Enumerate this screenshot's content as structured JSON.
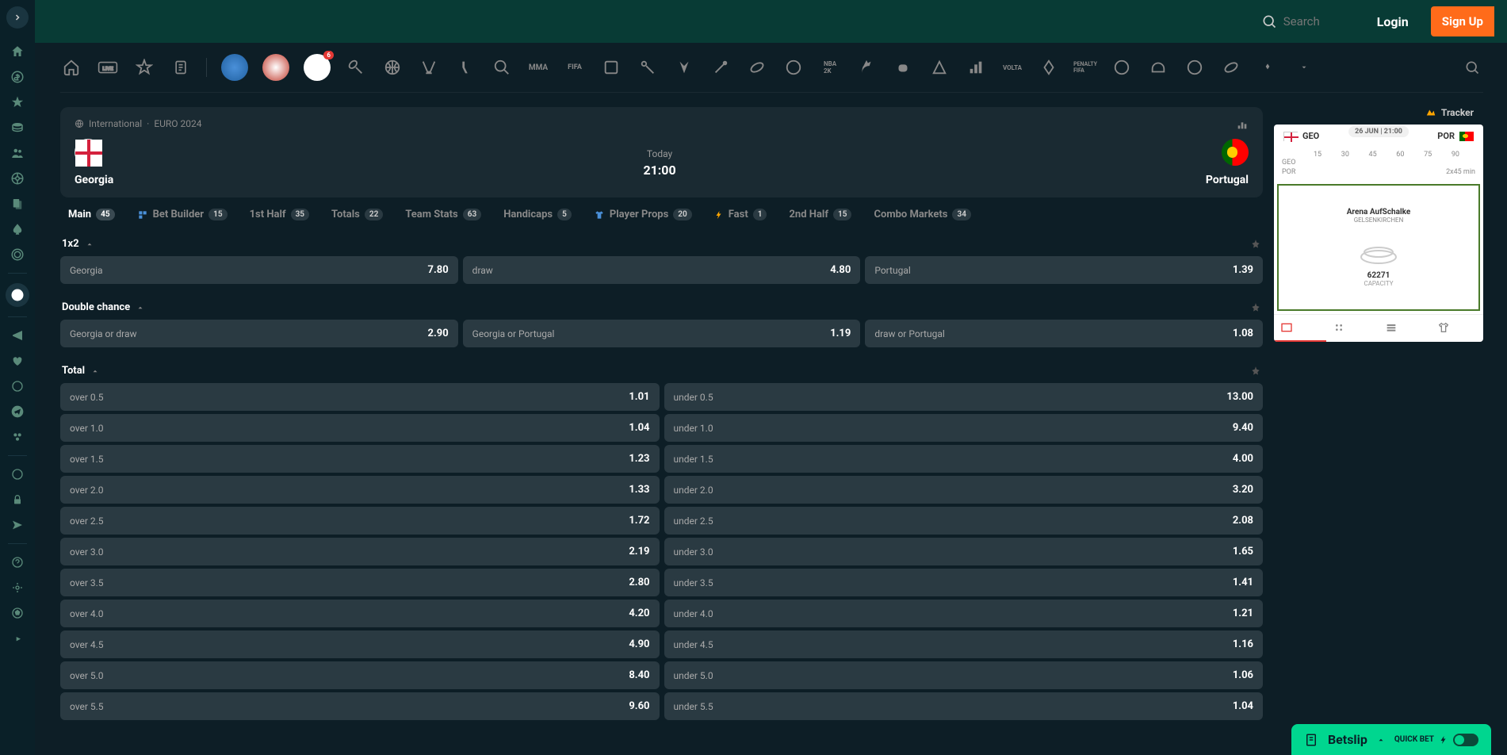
{
  "header": {
    "search_placeholder": "Search",
    "login": "Login",
    "signup": "Sign Up"
  },
  "breadcrumb": {
    "league": "International",
    "event": "EURO 2024"
  },
  "match": {
    "home_team": "Georgia",
    "away_team": "Portugal",
    "day": "Today",
    "time": "21:00"
  },
  "tabs": [
    {
      "label": "Main",
      "count": "45",
      "active": true
    },
    {
      "label": "Bet Builder",
      "count": "15",
      "icon": "builder"
    },
    {
      "label": "1st Half",
      "count": "35"
    },
    {
      "label": "Totals",
      "count": "22"
    },
    {
      "label": "Team Stats",
      "count": "63"
    },
    {
      "label": "Handicaps",
      "count": "5"
    },
    {
      "label": "Player Props",
      "count": "20",
      "icon": "shirt"
    },
    {
      "label": "Fast",
      "count": "1",
      "icon": "bolt"
    },
    {
      "label": "2nd Half",
      "count": "15"
    },
    {
      "label": "Combo Markets",
      "count": "34"
    }
  ],
  "markets": {
    "m1x2": {
      "title": "1x2",
      "items": [
        {
          "label": "Georgia",
          "odds": "7.80"
        },
        {
          "label": "draw",
          "odds": "4.80"
        },
        {
          "label": "Portugal",
          "odds": "1.39"
        }
      ]
    },
    "double_chance": {
      "title": "Double chance",
      "items": [
        {
          "label": "Georgia or draw",
          "odds": "2.90"
        },
        {
          "label": "Georgia or Portugal",
          "odds": "1.19"
        },
        {
          "label": "draw or Portugal",
          "odds": "1.08"
        }
      ]
    },
    "total": {
      "title": "Total",
      "rows": [
        {
          "over_label": "over 0.5",
          "over_odds": "1.01",
          "under_label": "under 0.5",
          "under_odds": "13.00"
        },
        {
          "over_label": "over 1.0",
          "over_odds": "1.04",
          "under_label": "under 1.0",
          "under_odds": "9.40"
        },
        {
          "over_label": "over 1.5",
          "over_odds": "1.23",
          "under_label": "under 1.5",
          "under_odds": "4.00"
        },
        {
          "over_label": "over 2.0",
          "over_odds": "1.33",
          "under_label": "under 2.0",
          "under_odds": "3.20"
        },
        {
          "over_label": "over 2.5",
          "over_odds": "1.72",
          "under_label": "under 2.5",
          "under_odds": "2.08"
        },
        {
          "over_label": "over 3.0",
          "over_odds": "2.19",
          "under_label": "under 3.0",
          "under_odds": "1.65"
        },
        {
          "over_label": "over 3.5",
          "over_odds": "2.80",
          "under_label": "under 3.5",
          "under_odds": "1.41"
        },
        {
          "over_label": "over 4.0",
          "over_odds": "4.20",
          "under_label": "under 4.0",
          "under_odds": "1.21"
        },
        {
          "over_label": "over 4.5",
          "over_odds": "4.90",
          "under_label": "under 4.5",
          "under_odds": "1.16"
        },
        {
          "over_label": "over 5.0",
          "over_odds": "8.40",
          "under_label": "under 5.0",
          "under_odds": "1.06"
        },
        {
          "over_label": "over 5.5",
          "over_odds": "9.60",
          "under_label": "under 5.5",
          "under_odds": "1.04"
        }
      ]
    }
  },
  "tracker": {
    "title": "Tracker",
    "home_code": "GEO",
    "away_code": "POR",
    "date": "26 JUN | 21:00",
    "ticks": [
      "15",
      "30",
      "45",
      "60",
      "75",
      "90"
    ],
    "duration": "2x45 min",
    "stadium": "Arena AufSchalke",
    "city": "GELSENKIRCHEN",
    "capacity_num": "62271",
    "capacity_label": "CAPACITY"
  },
  "betslip": {
    "label": "Betslip",
    "quickbet": "QUICK BET"
  },
  "sports_badge": "6"
}
